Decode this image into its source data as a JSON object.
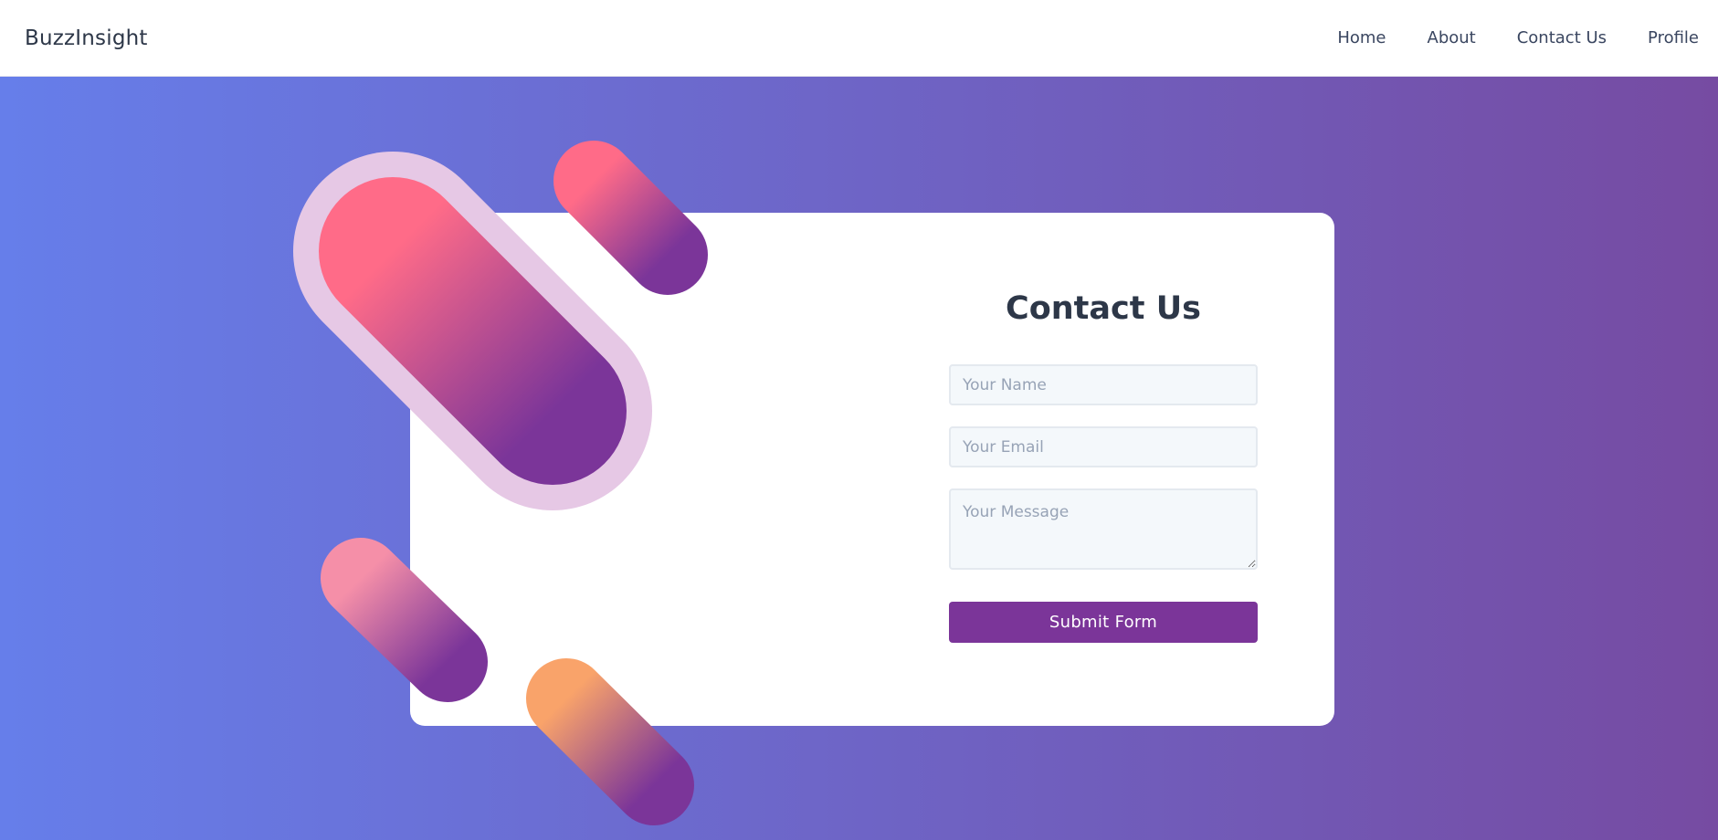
{
  "app": {
    "brand": "BuzzInsight"
  },
  "nav": {
    "items": [
      {
        "label": "Home"
      },
      {
        "label": "About"
      },
      {
        "label": "Contact Us"
      },
      {
        "label": "Profile"
      }
    ]
  },
  "contact_form": {
    "title": "Contact Us",
    "name_placeholder": "Your Name",
    "email_placeholder": "Your Email",
    "message_placeholder": "Your Message",
    "submit_label": "Submit Form"
  },
  "colors": {
    "background_gradient_start": "#667eea",
    "background_gradient_end": "#764ba2",
    "submit_button": "#7b3599",
    "heading_text": "#2d3748"
  }
}
